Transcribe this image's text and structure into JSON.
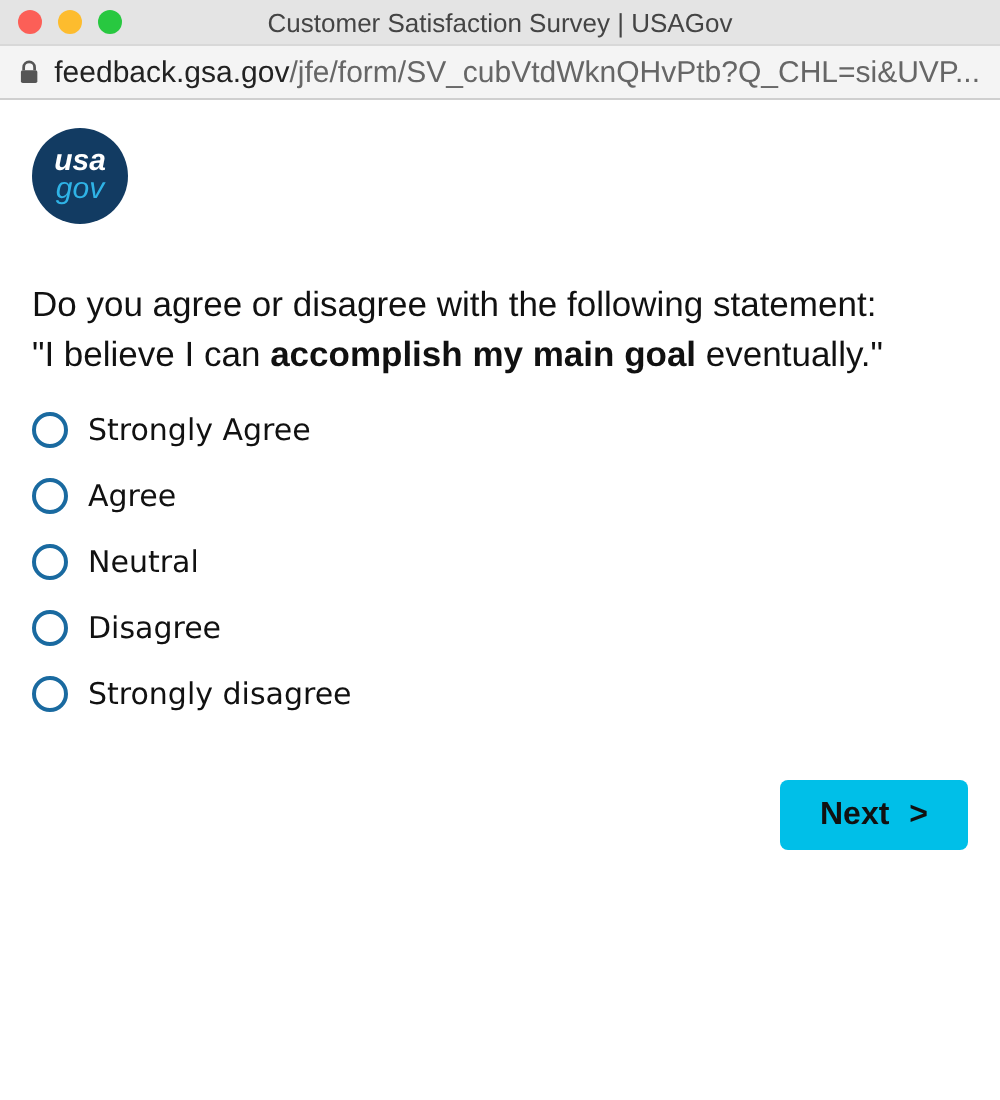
{
  "window": {
    "title": "Customer Satisfaction Survey | USAGov"
  },
  "address_bar": {
    "host": "feedback.gsa.gov",
    "path": "/jfe/form/SV_cubVtdWknQHvPtb?Q_CHL=si&UVP..."
  },
  "logo": {
    "line_1": "usa",
    "line_2": "gov"
  },
  "question": {
    "line_1": "Do you agree or disagree with the following statement:",
    "line_2": "\"I believe I can **accomplish my main goal** eventually.\""
  },
  "options": [
    {
      "label": "Strongly Agree",
      "selected": false
    },
    {
      "label": "Agree",
      "selected": false
    },
    {
      "label": "Neutral",
      "selected": false
    },
    {
      "label": "Disagree",
      "selected": false
    },
    {
      "label": "Strongly disagree",
      "selected": false
    }
  ],
  "next_button": {
    "label": "Next",
    "arrow": ">"
  }
}
